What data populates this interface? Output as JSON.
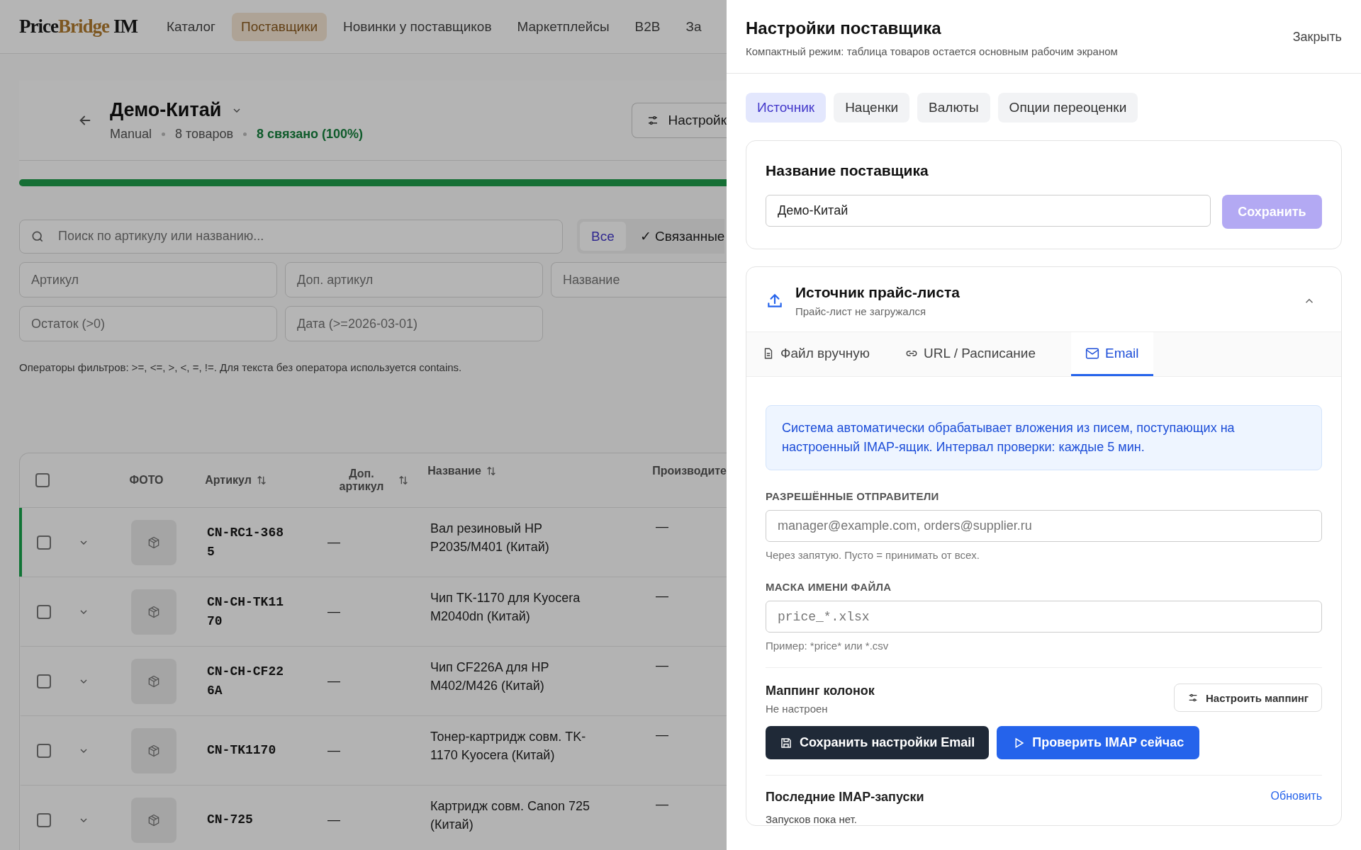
{
  "logo": [
    {
      "text": "Price",
      "accent": false
    },
    {
      "text": "Bridge",
      "accent": true
    },
    {
      "text": "IM",
      "accent": false
    }
  ],
  "nav": [
    {
      "label": "Каталог",
      "selected": false
    },
    {
      "label": "Поставщики",
      "selected": true
    },
    {
      "label": "Новинки у поставщиков",
      "selected": false
    },
    {
      "label": "Маркетплейсы",
      "selected": false
    },
    {
      "label": "B2B",
      "selected": false
    },
    {
      "label": "За",
      "selected": false
    }
  ],
  "supplier": {
    "name": "Демо-Китай",
    "meta": [
      {
        "text": "Manual",
        "kind": "plain"
      },
      {
        "text": "8 товаров",
        "kind": "plain"
      },
      {
        "text": "8 связано (100%)",
        "kind": "success"
      }
    ],
    "settings_button": "Настройк",
    "progress": {
      "level": 1
    }
  },
  "search": {
    "placeholder": "Поиск по артикулу или названию..."
  },
  "chips": [
    {
      "label": "Все",
      "selected": true
    },
    {
      "label": "✓ Связанные",
      "selected": false
    }
  ],
  "filters": [
    {
      "placeholder": "Артикул"
    },
    {
      "placeholder": "Доп. артикул"
    },
    {
      "placeholder": "Название"
    },
    {
      "placeholder": "Остаток (>0)"
    },
    {
      "placeholder": "Дата (>=2026-03-01)"
    }
  ],
  "filter_hint": "Операторы фильтров: >=,  <=,  >,  <,  =,  !=. Для текста без оператора используется contains.",
  "table": {
    "all_checked": false,
    "columns": [
      {
        "label": "ФОТО",
        "sortable": false
      },
      {
        "label": "Артикул",
        "sortable": true
      },
      {
        "label": "Доп. артикул",
        "sortable": true
      },
      {
        "label": "Название",
        "sortable": true
      },
      {
        "label": "Производите",
        "sortable": false
      }
    ],
    "rows": [
      {
        "checked": false,
        "active": true,
        "sku": "CN-RC1-3685",
        "alt": "—",
        "name": "Вал резиновый HP P2035/M401 (Китай)",
        "maker": "—"
      },
      {
        "checked": false,
        "active": false,
        "sku": "CN-CH-TK1170",
        "alt": "—",
        "name": "Чип TK-1170 для Kyocera M2040dn (Китай)",
        "maker": "—"
      },
      {
        "checked": false,
        "active": false,
        "sku": "CN-CH-CF226A",
        "alt": "—",
        "name": "Чип CF226A для HP M402/M426 (Китай)",
        "maker": "—"
      },
      {
        "checked": false,
        "active": false,
        "sku": "CN-TK1170",
        "alt": "—",
        "name": "Тонер-картридж совм. TK-1170 Kyocera (Китай)",
        "maker": "—"
      },
      {
        "checked": false,
        "active": false,
        "sku": "CN-725",
        "alt": "—",
        "name": "Картридж совм. Canon 725 (Китай)",
        "maker": "—"
      }
    ]
  },
  "drawer": {
    "title": "Настройки поставщика",
    "subtitle": "Компактный режим: таблица товаров остается основным рабочим экраном",
    "close": "Закрыть",
    "tabs": [
      {
        "label": "Источник",
        "selected": true
      },
      {
        "label": "Наценки",
        "selected": false
      },
      {
        "label": "Валюты",
        "selected": false
      },
      {
        "label": "Опции переоценки",
        "selected": false
      }
    ],
    "name_card": {
      "heading": "Название поставщика",
      "value": "Демо-Китай",
      "save": {
        "label": "Сохранить",
        "disabled": true
      }
    },
    "source_card": {
      "title": "Источник прайс-листа",
      "subtitle": "Прайс-лист не загружался",
      "expanded": true,
      "tabs": [
        {
          "label": "Файл вручную",
          "kind": "file",
          "selected": false
        },
        {
          "label": "URL / Расписание",
          "kind": "link",
          "selected": false
        },
        {
          "label": "Email",
          "kind": "mail",
          "selected": true
        }
      ],
      "info": "Система автоматически обрабатывает вложения из писем, поступающих на настроенный IMAP-ящик. Интервал проверки: каждые 5 мин.",
      "fields": [
        {
          "label": "РАЗРЕШЁННЫЕ ОТПРАВИТЕЛИ",
          "placeholder": "manager@example.com, orders@supplier.ru",
          "kind": "text",
          "hint": "Через запятую. Пусто = принимать от всех."
        },
        {
          "label": "МАСКА ИМЕНИ ФАЙЛА",
          "placeholder": "price_*.xlsx",
          "kind": "mono",
          "hint": "Пример: *price* или *.csv"
        }
      ],
      "mapping": {
        "title": "Маппинг колонок",
        "status": "Не настроен",
        "button": "Настроить маппинг"
      },
      "actions": [
        {
          "label": "Сохранить настройки Email",
          "kind": "save"
        },
        {
          "label": "Проверить IMAP сейчас",
          "kind": "play"
        }
      ],
      "runs": {
        "title": "Последние IMAP-запуски",
        "refresh": "Обновить",
        "empty": "Запусков пока нет."
      }
    }
  }
}
